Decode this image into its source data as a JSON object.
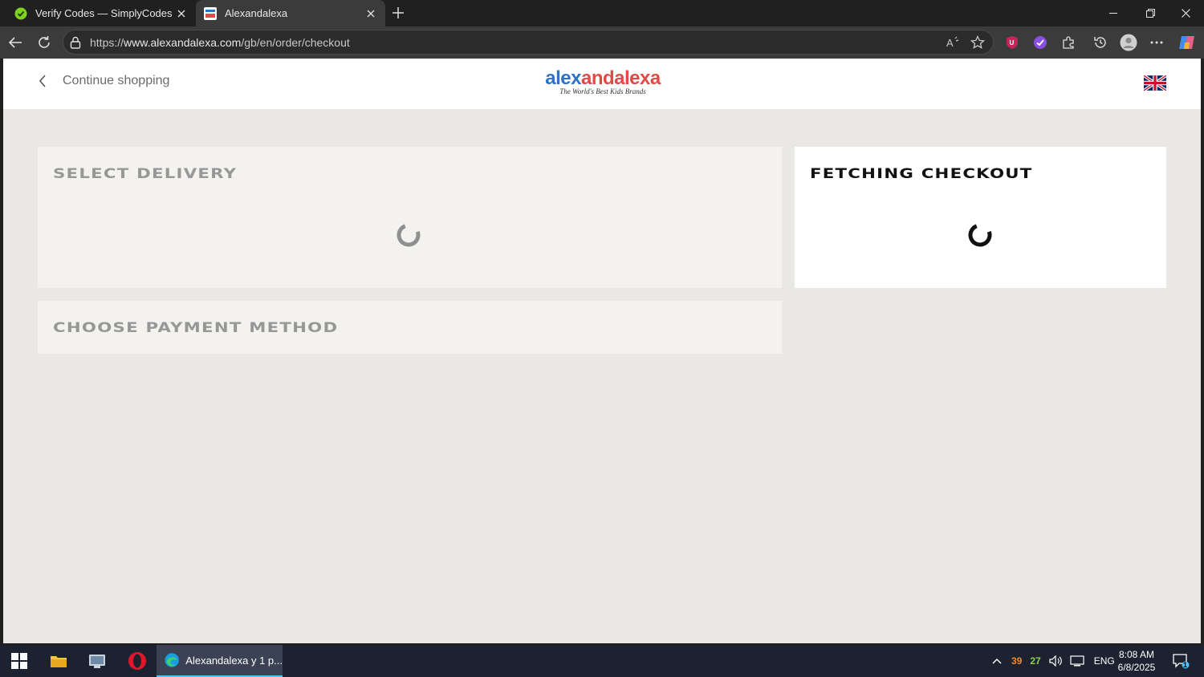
{
  "browser": {
    "tabs": [
      {
        "title": "Verify Codes — SimplyCodes",
        "icon": "simplycodes-icon",
        "active": false
      },
      {
        "title": "Alexandalexa",
        "icon": "alexandalexa-favicon",
        "active": true
      }
    ],
    "url": "https://www.alexandalexa.com/gb/en/order/checkout",
    "url_parts": {
      "prefix": "https://",
      "domain": "www.alexandalexa.com",
      "path": "/gb/en/order/checkout"
    }
  },
  "site": {
    "back_label": "Continue shopping",
    "logo": {
      "part1": "alex",
      "part2": "and",
      "part3": "alexa",
      "tagline": "The World's Best Kids Brands"
    },
    "locale_flag": "uk-flag"
  },
  "checkout": {
    "delivery_title": "SELECT DELIVERY",
    "payment_title": "CHOOSE PAYMENT METHOD",
    "summary_title": "FETCHING CHECKOUT"
  },
  "taskbar": {
    "active_app_label": "Alexandalexa y 1 p...",
    "tray_num1": "39",
    "tray_num2": "27",
    "language": "ENG",
    "time": "8:08 AM",
    "date": "6/8/2025",
    "notifications": "1"
  },
  "colors": {
    "logo_blue": "#2f71c5",
    "logo_red": "#e04a47",
    "page_bg": "#e9e8e5"
  }
}
